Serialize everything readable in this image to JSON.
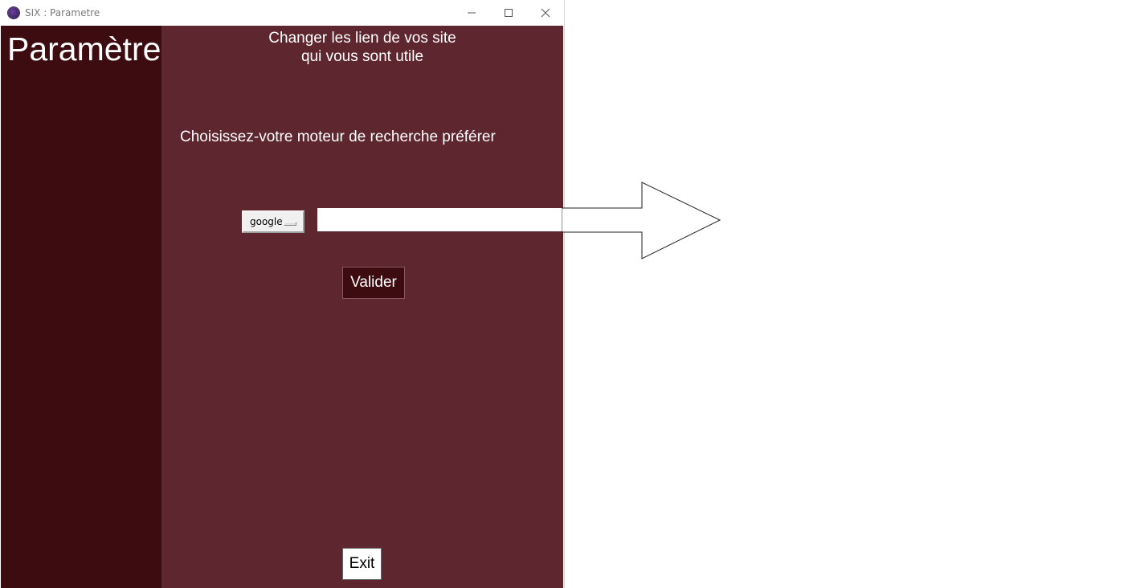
{
  "window": {
    "title": "SIX : Parametre",
    "controls": {
      "minimize": "minimize",
      "maximize": "maximize",
      "close": "close"
    }
  },
  "sidebar": {
    "title": "Paramètre"
  },
  "main": {
    "heading_line1": "Changer les lien de vos site",
    "heading_line2": "qui vous sont utile",
    "subheading": "Choisissez-votre moteur de recherche préférer",
    "search_engine": {
      "selected": "google"
    },
    "url_input": {
      "value": "",
      "placeholder": ""
    },
    "valider_label": "Valider",
    "exit_label": "Exit"
  },
  "colors": {
    "sidebar_bg": "#3d0c11",
    "main_bg": "#5e262e",
    "text": "#ffffff"
  },
  "icons": {
    "app": "app-icon",
    "minimize": "minimize-icon",
    "maximize": "maximize-icon",
    "close": "close-icon",
    "dropdown": "dropdown-indicator-icon"
  }
}
